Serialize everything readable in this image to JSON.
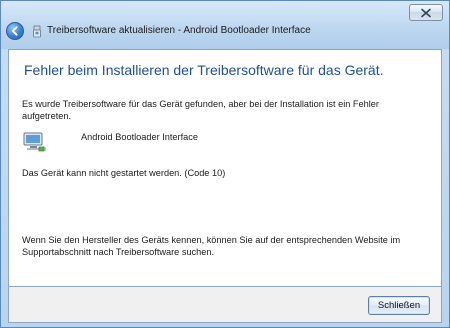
{
  "window": {
    "title": "Treibersoftware aktualisieren - Android Bootloader Interface"
  },
  "content": {
    "headline": "Fehler beim Installieren der Treibersoftware für das Gerät.",
    "intro": "Es wurde Treibersoftware für das Gerät gefunden, aber bei der Installation ist ein Fehler aufgetreten.",
    "device_name": "Android Bootloader Interface",
    "error_text": "Das Gerät kann nicht gestartet werden. (Code 10)",
    "hint": "Wenn Sie den Hersteller des Geräts kennen, können Sie auf der entsprechenden Website im Supportabschnitt nach Treibersoftware suchen."
  },
  "footer": {
    "close_label": "Schließen"
  },
  "icons": {
    "back": "back-arrow-icon",
    "title_device": "usb-device-icon",
    "device": "network-adapter-icon",
    "close_window": "close-icon"
  },
  "colors": {
    "headline": "#1f4f9a",
    "window_frame": "#bcd6ef",
    "content_bg": "#ffffff",
    "footer_bg": "#f0f0f0"
  }
}
